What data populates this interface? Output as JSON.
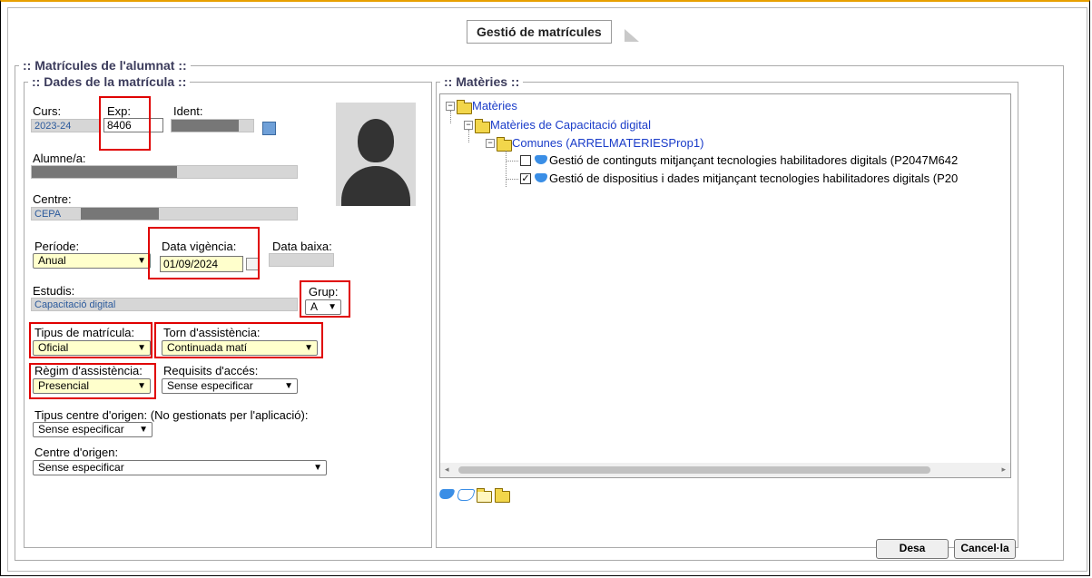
{
  "title": "Gestió de matrícules",
  "outer_legend": ":: Matrícules de l'alumnat ::",
  "dades_legend": ":: Dades de la matrícula ::",
  "materies_legend": ":: Matèries ::",
  "fields": {
    "curs_label": "Curs:",
    "curs_value": "2023-24",
    "exp_label": "Exp:",
    "exp_value": "8406",
    "ident_label": "Ident:",
    "alumne_label": "Alumne/a:",
    "centre_label": "Centre:",
    "centre_value": "CEPA",
    "periode_label": "Període:",
    "periode_value": "Anual",
    "data_vigencia_label": "Data vigència:",
    "data_vigencia_value": "01/09/2024",
    "data_baixa_label": "Data baixa:",
    "estudis_label": "Estudis:",
    "estudis_value": "Capacitació digital",
    "grup_label": "Grup:",
    "grup_value": "A",
    "tipus_matricula_label": "Tipus de matrícula:",
    "tipus_matricula_value": "Oficial",
    "torn_label": "Torn d'assistència:",
    "torn_value": "Continuada matí",
    "regim_label": "Règim d'assistència:",
    "regim_value": "Presencial",
    "requisits_label": "Requisits d'accés:",
    "requisits_value": "Sense especificar",
    "tipus_centre_label": "Tipus centre d'origen: (No gestionats per l'aplicació):",
    "tipus_centre_value": "Sense especificar",
    "centre_origen_label": "Centre d'origen:",
    "centre_origen_value": "Sense especificar"
  },
  "tree": {
    "root": "Matèries",
    "level1": "Matèries de Capacitació digital",
    "level2": "Comunes (ARRELMATERIESProp1)",
    "item1": "Gestió de continguts mitjançant tecnologies habilitadores digitals (P2047M642",
    "item2": "Gestió de dispositius i dades mitjançant tecnologies habilitadores digitals (P20"
  },
  "buttons": {
    "save": "Desa",
    "cancel": "Cancel·la"
  },
  "colors": {
    "highlight": "#e00000",
    "input_yellow": "#ffffcc",
    "link_blue": "#1a3cc9"
  }
}
